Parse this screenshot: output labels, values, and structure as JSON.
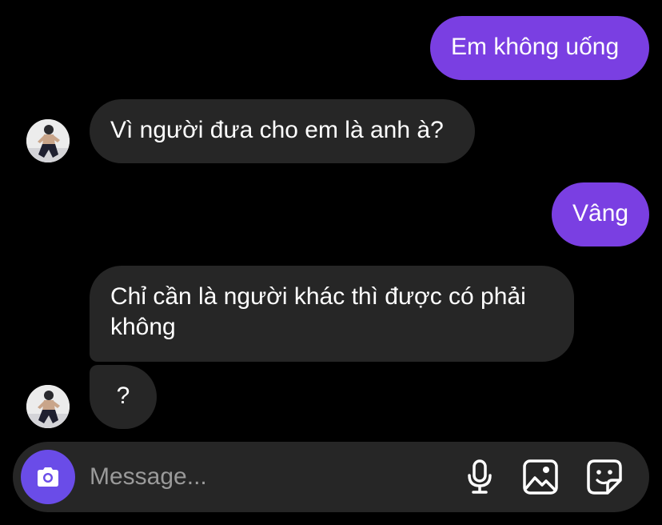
{
  "messages": [
    {
      "from": "me",
      "text": "Em không uống"
    },
    {
      "from": "them",
      "text": "Vì người đưa cho em là anh à?"
    },
    {
      "from": "me",
      "text": "Vâng"
    },
    {
      "from": "them",
      "text": "Chỉ cần là người khác thì được có phải không"
    },
    {
      "from": "them",
      "text": "?"
    }
  ],
  "composer": {
    "placeholder": "Message...",
    "icons": [
      "camera-icon",
      "microphone-icon",
      "gallery-icon",
      "sticker-icon"
    ]
  },
  "colors": {
    "background": "#000000",
    "outgoing_bubble": "#7a3fe2",
    "incoming_bubble": "#262626",
    "composer": "#262626",
    "camera_button": "#6a4ce8"
  }
}
